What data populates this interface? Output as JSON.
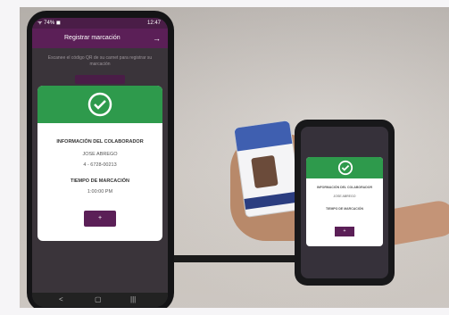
{
  "big_phone": {
    "status_left": "ᯤ 74% ◼",
    "status_right": "12:47",
    "app_title": "Registrar marcación",
    "back_arrow": "→",
    "background_text": "Escanee el código QR de su carnet para registrar su marcación",
    "card": {
      "info_heading": "INFORMACIÓN DEL COLABORADOR",
      "name": "JOSE ABREGO",
      "phone": "4 - 6728-00213",
      "time_heading": "TIEMPO DE MARCACIÓN",
      "time_value": "1:00:00 PM",
      "button_label": "+"
    },
    "nav": {
      "back": "<",
      "home": "▢",
      "recent": "|||"
    }
  },
  "small_phone": {
    "info_heading": "INFORMACIÓN DEL COLABORADOR",
    "name": "JOSE ABREGO",
    "time_heading": "TIEMPO DE MARCACIÓN",
    "button_label": "+"
  },
  "colors": {
    "accent_purple": "#5b1f57",
    "success_green": "#2e9a4c"
  }
}
